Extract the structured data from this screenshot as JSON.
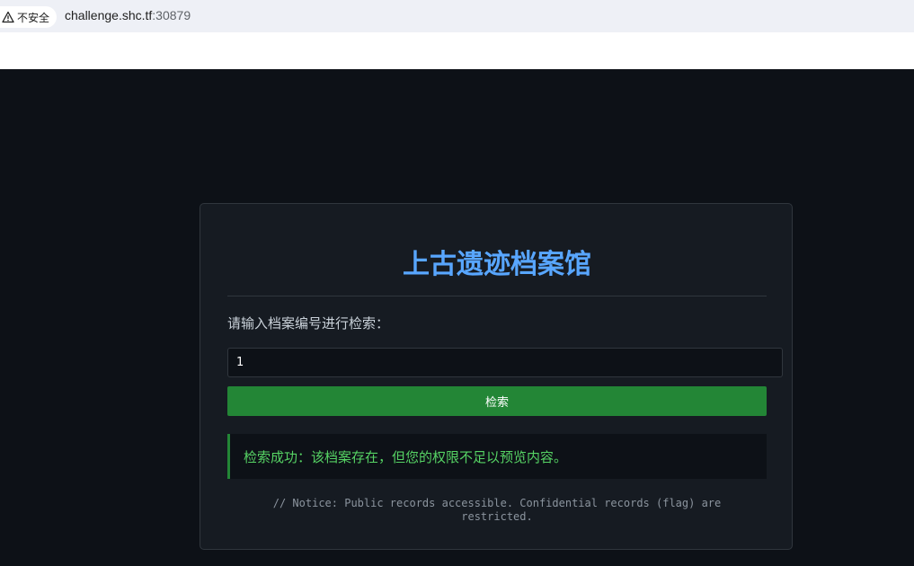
{
  "browser": {
    "security_label": "不安全",
    "url_host": "challenge.shc.tf",
    "url_port": ":30879"
  },
  "icons": {
    "security": "warning-triangle-icon"
  },
  "colors": {
    "background": "#0d1117",
    "card": "#161b22",
    "title": "#58a6ff",
    "button": "#238636",
    "success_text": "#56d364"
  },
  "card": {
    "title": "上古遗迹档案馆",
    "prompt": "请输入档案编号进行检索：",
    "search_input_value": "1",
    "search_button_label": "检索",
    "result_message": "检索成功：该档案存在，但您的权限不足以预览内容。",
    "notice": "// Notice: Public records accessible. Confidential records (flag) are restricted."
  }
}
